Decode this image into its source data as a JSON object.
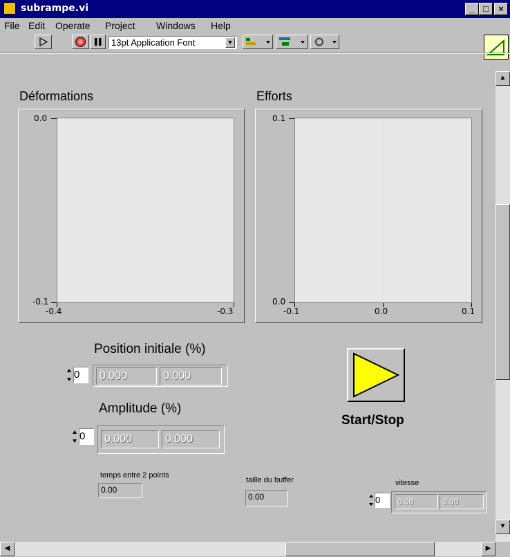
{
  "window": {
    "title": "subrampe.vi",
    "minimize": "_",
    "maximize": "□",
    "close": "×"
  },
  "menu": [
    "File",
    "Edit",
    "Operate",
    "Project",
    "Windows",
    "Help"
  ],
  "toolbar": {
    "font": "13pt Application Font"
  },
  "graphs": [
    {
      "title": "Déformations",
      "y_ticks": [
        "0.0",
        "-0.1"
      ],
      "x_ticks": [
        "-0.4",
        "-0.3"
      ]
    },
    {
      "title": "Efforts",
      "y_ticks": [
        "0.1",
        "0.0"
      ],
      "x_ticks": [
        "-0.1",
        "0.0",
        "0.1"
      ],
      "cursor_color": "#ffff00"
    }
  ],
  "controls": {
    "position": {
      "label": "Position initiale (%)",
      "index": "0",
      "values": [
        "0.000",
        "0.000"
      ]
    },
    "amplitude": {
      "label": "Amplitude (%)",
      "index": "0",
      "values": [
        "0.000",
        "0.000"
      ]
    },
    "temps": {
      "label": "temps entre 2 points",
      "value": "0.00"
    },
    "buffer": {
      "label": "taille du buffer",
      "value": "0.00"
    },
    "vitesse": {
      "label": "vitesse",
      "index": "0",
      "values": [
        "0.00",
        "0.00"
      ]
    },
    "start": {
      "label": "Start/Stop",
      "icon": "play-icon",
      "color": "#ffff00"
    }
  }
}
